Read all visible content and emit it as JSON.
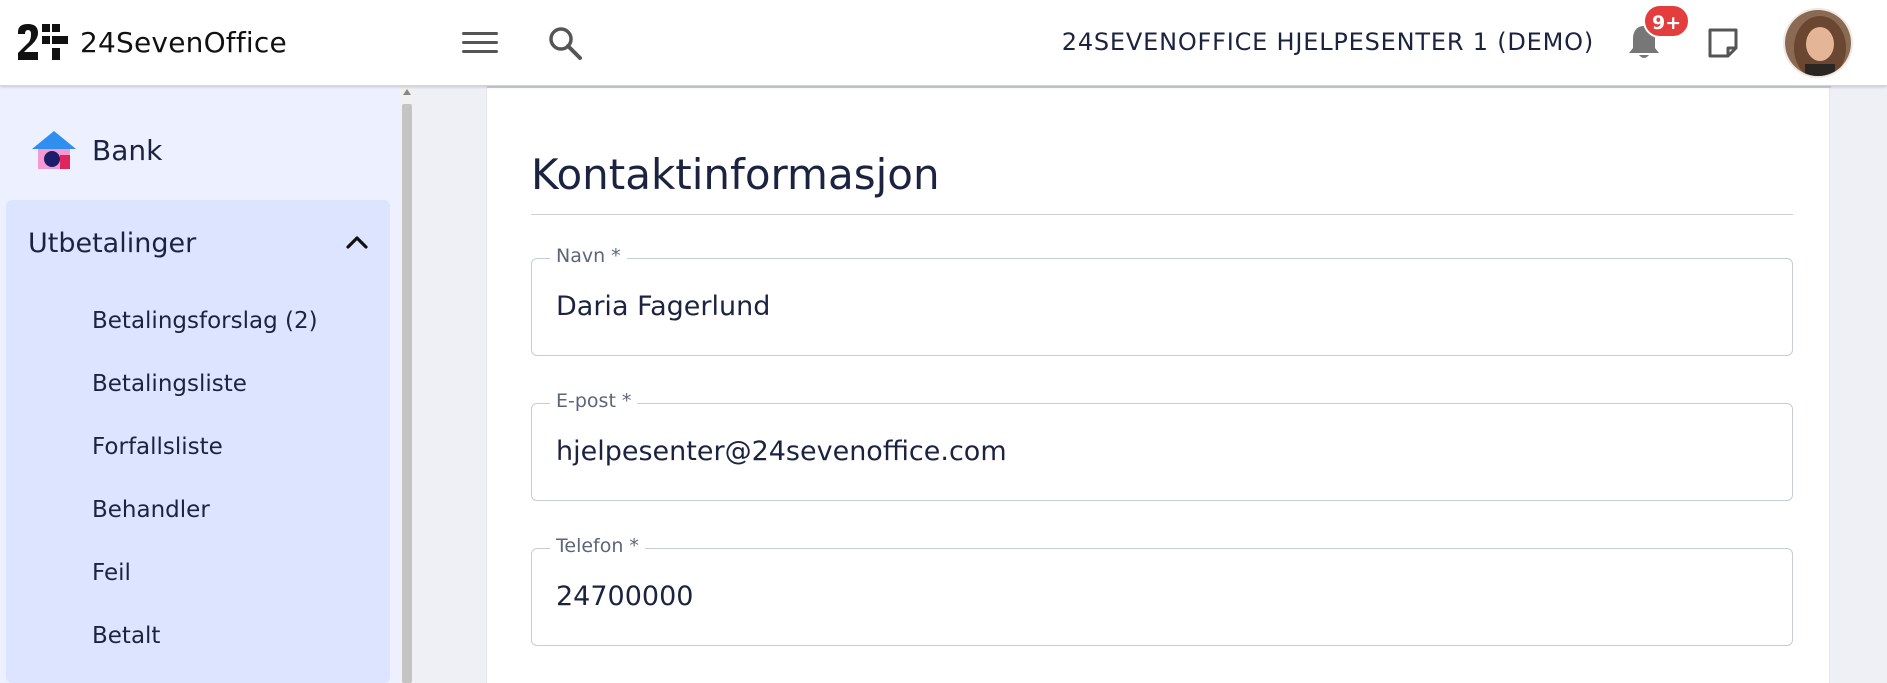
{
  "app": {
    "brand": "24SevenOffice",
    "company": "24SEVENOFFICE HJELPESENTER 1 (DEMO)",
    "notification_badge": "9+"
  },
  "sidebar": {
    "section": "Bank",
    "group_label": "Utbetalinger",
    "items": [
      {
        "label": "Betalingsforslag (2)"
      },
      {
        "label": "Betalingsliste"
      },
      {
        "label": "Forfallsliste"
      },
      {
        "label": "Behandler"
      },
      {
        "label": "Feil"
      },
      {
        "label": "Betalt"
      }
    ]
  },
  "main": {
    "section_title": "Kontaktinformasjon",
    "fields": [
      {
        "label": "Navn *",
        "value": "Daria Fagerlund"
      },
      {
        "label": "E-post *",
        "value": "hjelpesenter@24sevenoffice.com"
      },
      {
        "label": "Telefon *",
        "value": "24700000"
      }
    ]
  },
  "colors": {
    "sidebar_bg": "#edf1ff",
    "group_bg": "#dce4ff",
    "text": "#1c2340",
    "badge": "#e43d3d"
  },
  "icons": [
    "menu-icon",
    "search-icon",
    "bell-icon",
    "note-icon",
    "bank-icon",
    "chevron-up-icon"
  ]
}
